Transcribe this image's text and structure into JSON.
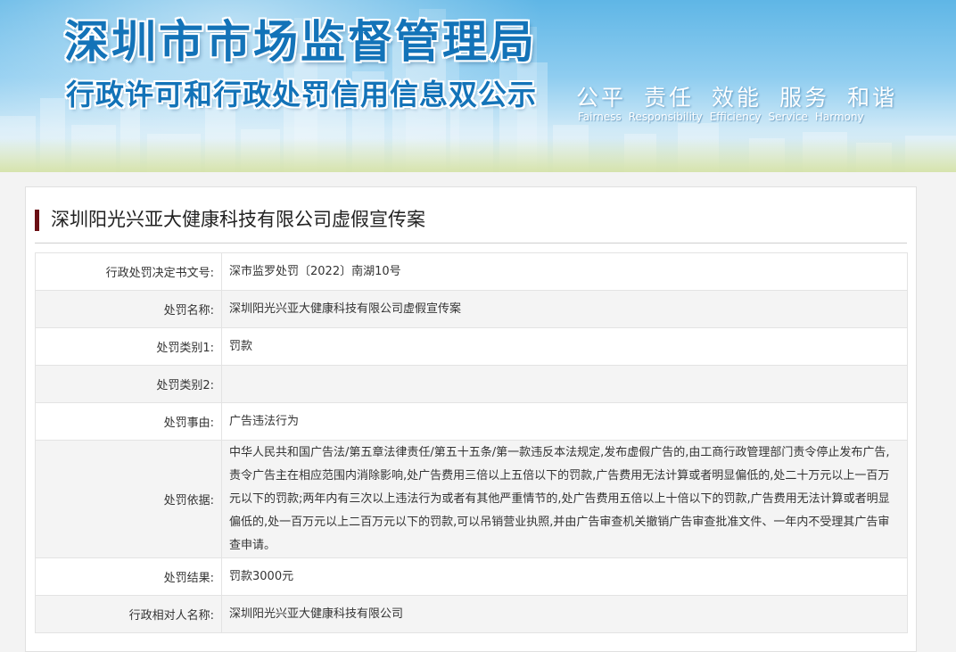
{
  "banner": {
    "title": "深圳市市场监督管理局",
    "subtitle": "行政许可和行政处罚信用信息双公示",
    "motto_cn": [
      "公平",
      "责任",
      "效能",
      "服务",
      "和谐"
    ],
    "motto_en": [
      "Fairness",
      "Responsibility",
      "Efficiency",
      "Service",
      "Harmony"
    ]
  },
  "case": {
    "title": "深圳阳光兴亚大健康科技有限公司虚假宣传案",
    "rows": [
      {
        "label": "行政处罚决定书文号:",
        "value": "深市监罗处罚〔2022〕南湖10号"
      },
      {
        "label": "处罚名称:",
        "value": "深圳阳光兴亚大健康科技有限公司虚假宣传案"
      },
      {
        "label": "处罚类别1:",
        "value": "罚款"
      },
      {
        "label": "处罚类别2:",
        "value": ""
      },
      {
        "label": "处罚事由:",
        "value": "广告违法行为"
      },
      {
        "label": "处罚依据:",
        "value": "中华人民共和国广告法/第五章法律责任/第五十五条/第一款违反本法规定,发布虚假广告的,由工商行政管理部门责令停止发布广告,责令广告主在相应范围内消除影响,处广告费用三倍以上五倍以下的罚款,广告费用无法计算或者明显偏低的,处二十万元以上一百万元以下的罚款;两年内有三次以上违法行为或者有其他严重情节的,处广告费用五倍以上十倍以下的罚款,广告费用无法计算或者明显偏低的,处一百万元以上二百万元以下的罚款,可以吊销营业执照,并由广告审查机关撤销广告审查批准文件、一年内不受理其广告审查申请。"
      },
      {
        "label": "处罚结果:",
        "value": "罚款3000元"
      },
      {
        "label": "行政相对人名称:",
        "value": "深圳阳光兴亚大健康科技有限公司"
      }
    ]
  },
  "colors": {
    "banner_text": "#1373b8",
    "title_bar": "#6b0f14"
  }
}
